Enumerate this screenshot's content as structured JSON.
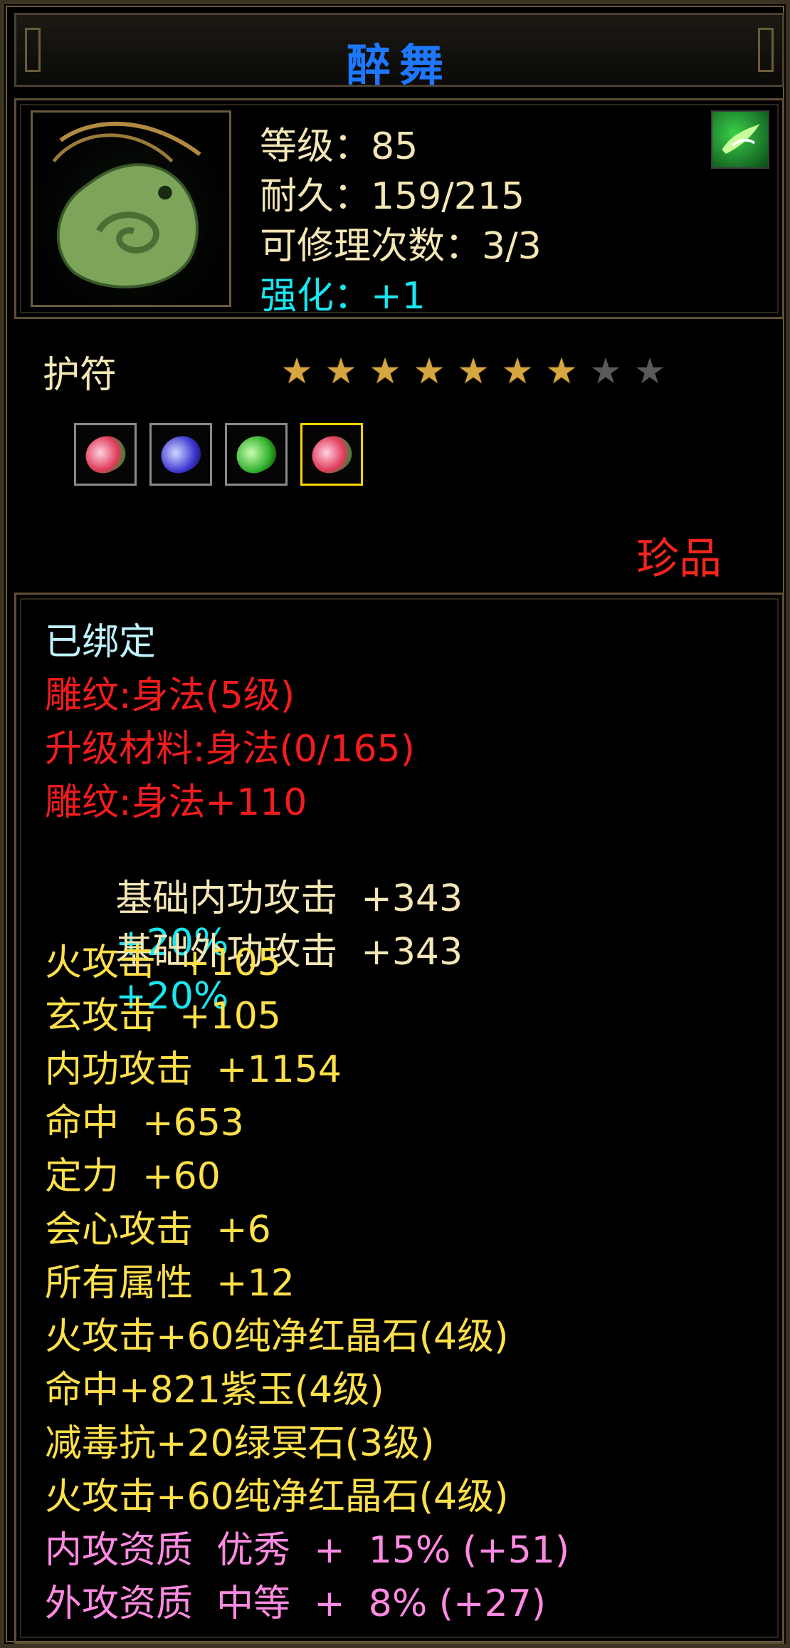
{
  "item": {
    "name": "醉舞",
    "level": "等级：85",
    "durability": "耐久：159/215",
    "repairs": "可修理次数：3/3",
    "enhance": "强化：+1",
    "type": "护符",
    "stars_total": 9,
    "stars_filled": 7,
    "rarity": "珍品",
    "icon": "jade-amulet-icon",
    "badge_icon": "green-wind-icon"
  },
  "gems": [
    {
      "icon": "red-gem-icon",
      "selected": false
    },
    {
      "icon": "blue-gem-icon",
      "selected": false
    },
    {
      "icon": "green-gem-icon",
      "selected": false
    },
    {
      "icon": "red-gem-icon",
      "selected": true
    }
  ],
  "attributes": {
    "bound": "已绑定",
    "engrave": "雕纹:身法(5级)",
    "upgrade": "升级材料:身法(0/165)",
    "engrave_bonus": "雕纹:身法+110",
    "base_inner": {
      "label": "基础内功攻击  +343",
      "pct": "+20%"
    },
    "base_outer": {
      "label": "基础外功攻击  +343",
      "pct": "+20%"
    },
    "fire": "火攻击  +105",
    "xuan": "玄攻击  +105",
    "inner": "内功攻击  +1154",
    "hit": "命中  +653",
    "focus": "定力  +60",
    "crit": "会心攻击  +6",
    "all": "所有属性  +12",
    "gem1": "火攻击+60纯净红晶石(4级)",
    "gem2": "命中+821紫玉(4级)",
    "gem3": "减毒抗+20绿冥石(3级)",
    "gem4": "火攻击+60纯净红晶石(4级)",
    "q_inner": "内攻资质  优秀  +  15% (+51)",
    "q_outer": "外攻资质  中等  +  8% (+27)"
  },
  "colors": {
    "title": "#1e78ff",
    "rarity": "#f4261c",
    "engrave": "#f21c1c",
    "gem_lines": "#ffe04a",
    "quality": "#ff8ae2",
    "percent": "#19e6f0"
  }
}
